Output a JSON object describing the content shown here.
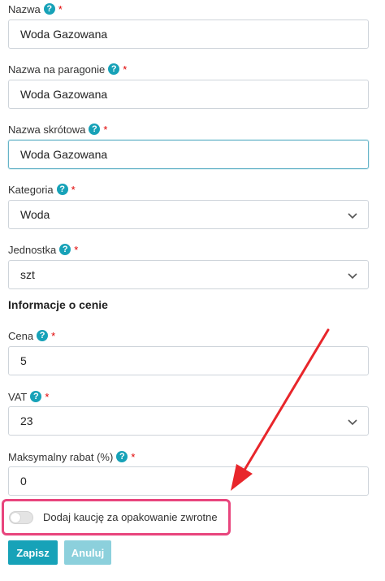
{
  "fields": {
    "nazwa": {
      "label": "Nazwa",
      "value": "Woda Gazowana"
    },
    "nazwa_paragon": {
      "label": "Nazwa na paragonie",
      "value": "Woda Gazowana"
    },
    "nazwa_skrot": {
      "label": "Nazwa skrótowa",
      "value": "Woda Gazowana"
    },
    "kategoria": {
      "label": "Kategoria",
      "value": "Woda"
    },
    "jednostka": {
      "label": "Jednostka",
      "value": "szt"
    },
    "cena": {
      "label": "Cena",
      "value": "5"
    },
    "vat": {
      "label": "VAT",
      "value": "23"
    },
    "rabat": {
      "label": "Maksymalny rabat (%)",
      "value": "0"
    }
  },
  "section": {
    "price_info": "Informacje o cenie"
  },
  "help": {
    "glyph": "?"
  },
  "required": {
    "mark": "*"
  },
  "deposit_toggle": {
    "label": "Dodaj kaucję za opakowanie zwrotne",
    "checked": false
  },
  "buttons": {
    "save": "Zapisz",
    "cancel": "Anuluj"
  },
  "colors": {
    "accent": "#17a2b8",
    "accent_disabled": "#8cd0dc",
    "highlight_box": "#e8457d",
    "annotation_arrow": "#e8262b",
    "required": "#e00000"
  }
}
